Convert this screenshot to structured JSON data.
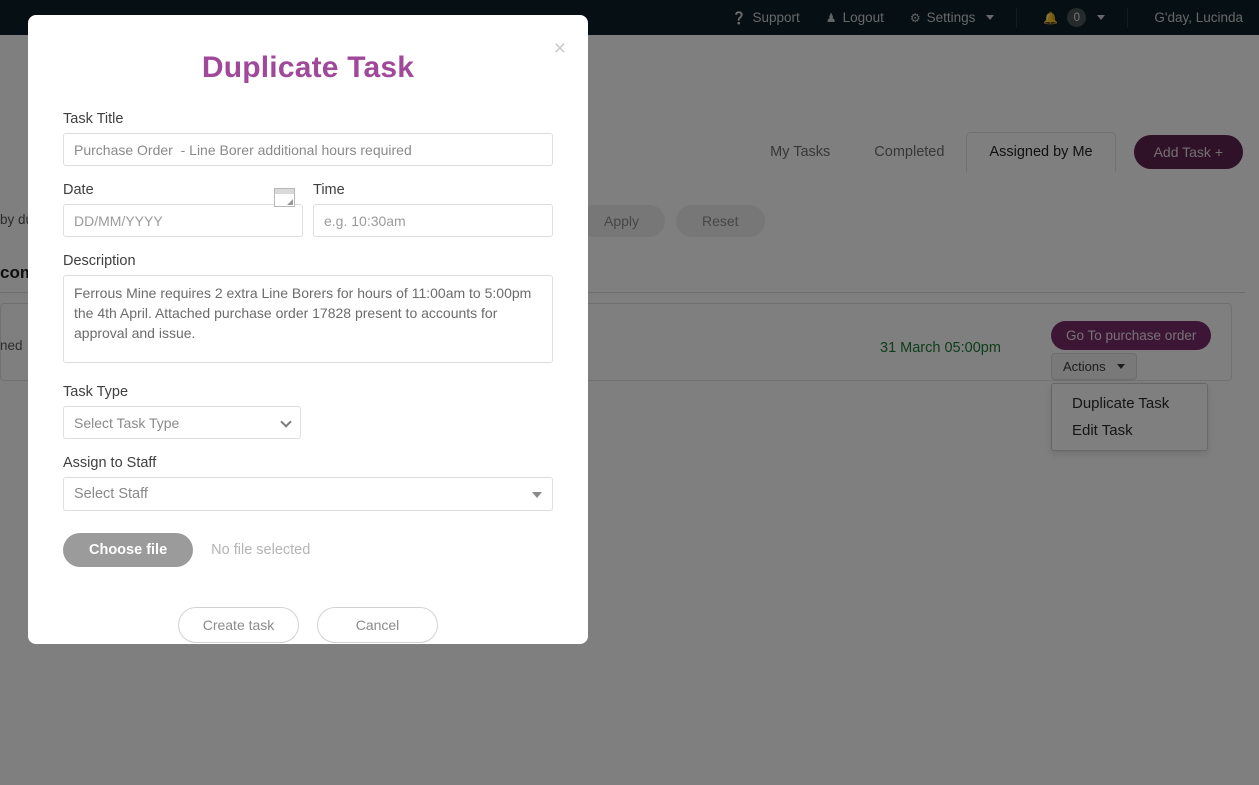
{
  "topbar": {
    "support": "Support",
    "logout": "Logout",
    "settings": "Settings",
    "notification_count": "0",
    "greeting": "G'day, Lucinda",
    "background": "#0d1f28"
  },
  "tabs": [
    {
      "label": "My Tasks",
      "active": false
    },
    {
      "label": "Completed",
      "active": false
    },
    {
      "label": "Assigned by Me",
      "active": true
    }
  ],
  "toolbar": {
    "add_task_label": "Add Task +",
    "add_task_color": "#7a2a6b"
  },
  "filters": {
    "sort_label": "by du",
    "apply_label": "Apply",
    "reset_label": "Reset"
  },
  "list": {
    "section_heading": "com",
    "assigned_text": "ned",
    "due_date": "31 March 05:00pm",
    "due_color": "#1c7a33",
    "goto_label": "Go To purchase order",
    "actions_label": "Actions",
    "actions_menu": [
      {
        "label": "Duplicate Task"
      },
      {
        "label": "Edit Task"
      }
    ]
  },
  "modal": {
    "title": "Duplicate Task",
    "title_color": "#a0499a",
    "close_label": "×",
    "task_title": {
      "label": "Task Title",
      "value": "Purchase Order  - Line Borer additional hours required"
    },
    "date": {
      "label": "Date",
      "placeholder": "DD/MM/YYYY",
      "value": ""
    },
    "time": {
      "label": "Time",
      "placeholder": "e.g. 10:30am",
      "value": ""
    },
    "description": {
      "label": "Description",
      "value": "Ferrous Mine requires 2 extra Line Borers for hours of 11:00am to 5:00pm the 4th April. Attached purchase order 17828 present to accounts for approval and issue."
    },
    "task_type": {
      "label": "Task Type",
      "selected": "Select Task Type",
      "options": [
        "Select Task Type"
      ]
    },
    "assign_staff": {
      "label": "Assign to Staff",
      "selected": "Select Staff"
    },
    "file": {
      "button_label": "Choose file",
      "status": "No file selected"
    },
    "submit_label": "Create task",
    "cancel_label": "Cancel"
  }
}
